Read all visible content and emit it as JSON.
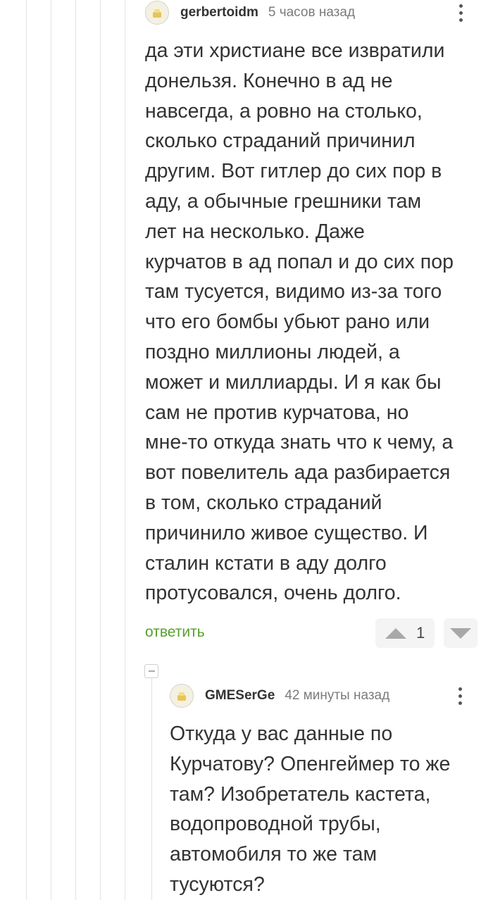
{
  "comments": [
    {
      "username": "gerbertoidm",
      "timestamp": "5 часов назад",
      "text": "да эти христиане все извратили\nдонельзя. Конечно в ад не\nнавсегда, а ровно на столько,\nсколько страданий причинил\nдругим. Вот гитлер до сих пор в\nаду, а обычные грешники там\nлет на несколько. Даже\nкурчатов в ад попал и до сих пор\nтам тусуется, видимо из-за того\nчто его бомбы убьют рано или\nпоздно миллионы людей, а\nможет и миллиарды. И я как бы\nсам не против курчатова, но\nмне-то откуда знать что к чему, а\nвот повелитель ада разбирается\nв том, сколько страданий\nпричинило живое существо. И\nсталин кстати в аду долго\nпротусовался, очень долго.",
      "reply_label": "ответить",
      "rating": "1"
    },
    {
      "username": "GMESerGe",
      "timestamp": "42 минуты назад",
      "text": "Откуда у вас данные по\nКурчатову? Опенгеймер то же\nтам? Изобретатель кастета,\nводопроводной трубы,\nавтомобиля то же там\nтусуются?"
    }
  ],
  "icons": {
    "avatar": "avatar-icon",
    "more": "more-vertical-icon",
    "upvote": "upvote-arrow-icon",
    "downvote": "downvote-arrow-icon",
    "collapse": "collapse-minus-icon"
  },
  "colors": {
    "reply_link": "#54a12a",
    "thread_line": "#e2e2e2",
    "vote_box": "#f4f4f4"
  }
}
